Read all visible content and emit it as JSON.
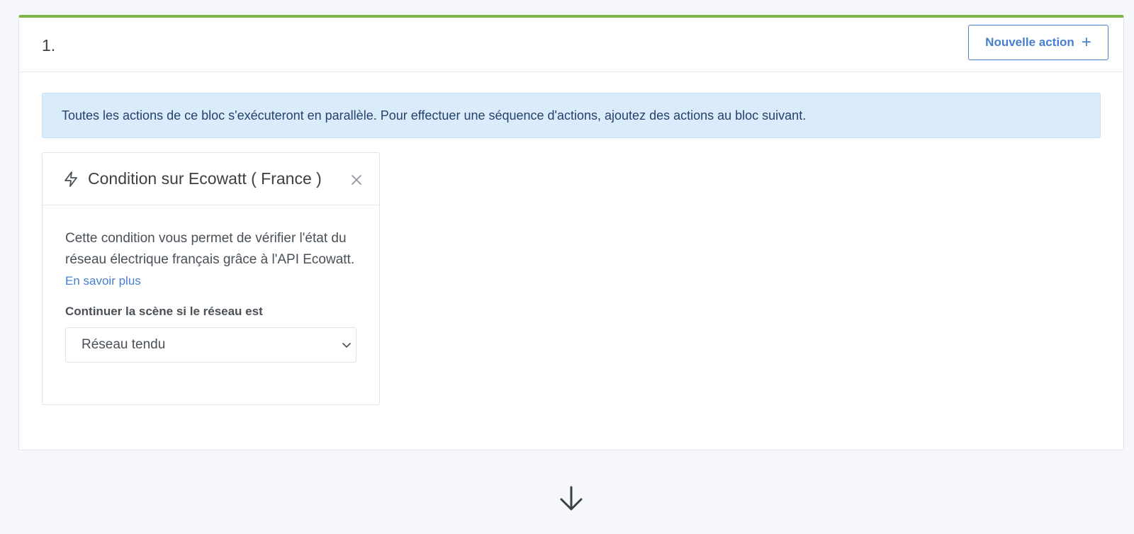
{
  "block": {
    "number": "1.",
    "new_action_label": "Nouvelle action",
    "new_action_icon": "plus-icon",
    "accent_color": "#7ab648",
    "info_message": "Toutes les actions de ce bloc s'exécuteront en parallèle. Pour effectuer une séquence d'actions, ajoutez des actions au bloc suivant."
  },
  "action": {
    "icon": "bolt-icon",
    "title": "Condition sur Ecowatt ( France )",
    "description": "Cette condition vous permet de vérifier l'état du réseau électrique français grâce à l'API Ecowatt.",
    "learn_more": "En savoir plus",
    "field_label": "Continuer la scène si le réseau est",
    "select_value": "Réseau tendu"
  },
  "icons": {
    "close": "close-icon",
    "chevron": "chevron-down-icon",
    "next_block": "arrow-down-icon"
  }
}
